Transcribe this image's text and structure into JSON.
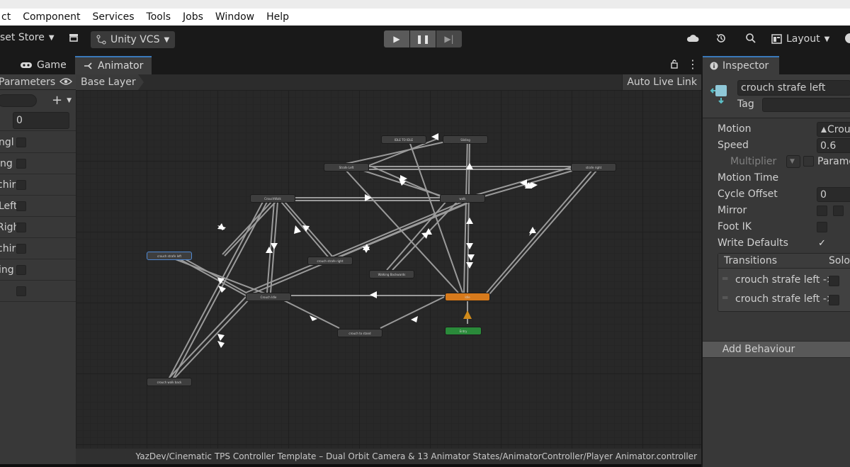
{
  "menubar": {
    "items": [
      "ct",
      "Component",
      "Services",
      "Tools",
      "Jobs",
      "Window",
      "Help"
    ]
  },
  "toolbar": {
    "asset_store": "set Store",
    "vcs": "Unity VCS",
    "layout": "Layout"
  },
  "tabs": [
    {
      "label": "Game",
      "icon": "gamepad-icon"
    },
    {
      "label": "Animator",
      "icon": "animator-icon"
    }
  ],
  "left_panel": {
    "header_label": "Parameters",
    "search_placeholder": "",
    "params": [
      {
        "name": "",
        "type": "float",
        "value": "0"
      },
      {
        "name": "ngl",
        "type": "bool"
      },
      {
        "name": "ng",
        "type": "bool"
      },
      {
        "name": "chir",
        "type": "bool"
      },
      {
        "name": "Left",
        "type": "bool"
      },
      {
        "name": "Righ",
        "type": "bool"
      },
      {
        "name": "chir",
        "type": "bool"
      },
      {
        "name": "ing",
        "type": "bool"
      },
      {
        "name": "",
        "type": "bool"
      }
    ]
  },
  "graph_header": {
    "breadcrumb": "Base Layer",
    "auto_live_link": "Auto Live Link"
  },
  "graph": {
    "states": [
      {
        "id": "s1",
        "label": "IDLE TO IDLE",
        "kind": "normal"
      },
      {
        "id": "s2",
        "label": "Sliding",
        "kind": "normal"
      },
      {
        "id": "s3",
        "label": "Strafe Left",
        "kind": "normal"
      },
      {
        "id": "s4",
        "label": "strafe right",
        "kind": "normal"
      },
      {
        "id": "s5",
        "label": "CrouchWalk",
        "kind": "normal"
      },
      {
        "id": "s6",
        "label": "walk",
        "kind": "normal"
      },
      {
        "id": "s7",
        "label": "crouch strafe left",
        "kind": "selected"
      },
      {
        "id": "s8",
        "label": "crouch strafe right",
        "kind": "normal"
      },
      {
        "id": "s9",
        "label": "Walking Backwards",
        "kind": "normal"
      },
      {
        "id": "s10",
        "label": "Crouch Idle",
        "kind": "normal"
      },
      {
        "id": "s11",
        "label": "Idle",
        "kind": "default"
      },
      {
        "id": "s12",
        "label": "Entry",
        "kind": "entry"
      },
      {
        "id": "s13",
        "label": "crouch to stand",
        "kind": "normal"
      },
      {
        "id": "s14",
        "label": "crouch walk back",
        "kind": "normal"
      }
    ]
  },
  "status_path": "YazDev/Cinematic TPS Controller Template – Dual Orbit Camera & 13 Animator States/AnimatorController/Player Animator.controller",
  "inspector": {
    "tab_label": "Inspector",
    "state_name": "crouch strafe left",
    "tag_label": "Tag",
    "tag_value": "",
    "props": [
      {
        "label": "Motion",
        "value": "Crou"
      },
      {
        "label": "Speed",
        "value": "0.6"
      },
      {
        "label": "Multiplier",
        "value": "Parame"
      },
      {
        "label": "Motion Time",
        "value": ""
      },
      {
        "label": "Cycle Offset",
        "value": "0"
      },
      {
        "label": "Mirror",
        "value": ""
      },
      {
        "label": "Foot IK",
        "value": ""
      },
      {
        "label": "Write Defaults",
        "value": ""
      }
    ],
    "write_defaults_checked": true,
    "transitions_header": "Transitions",
    "solo_label": "Solo",
    "transitions": [
      "crouch strafe left ->",
      "crouch strafe left ->"
    ],
    "add_behaviour": "Add Behaviour"
  }
}
